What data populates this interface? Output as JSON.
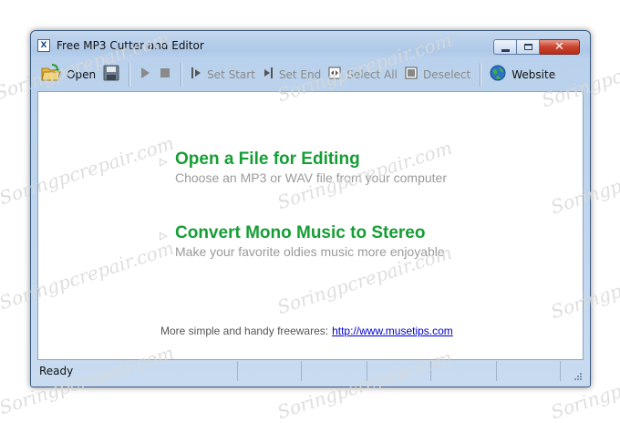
{
  "window": {
    "title": "Free MP3 Cutter and Editor",
    "app_icon_text": "X",
    "close_glyph": "✕"
  },
  "toolbar": {
    "open": "Open",
    "set_start": "Set Start",
    "set_end": "Set End",
    "select_all": "Select All",
    "deselect": "Deselect",
    "website": "Website"
  },
  "tasks": [
    {
      "title": "Open a File for Editing",
      "subtitle": "Choose an MP3 or WAV file from your computer"
    },
    {
      "title": "Convert Mono Music to Stereo",
      "subtitle": "Make your favorite oldies music more enjoyable"
    }
  ],
  "footer": {
    "text": "More simple and handy freewares:",
    "link": "http://www.musetips.com"
  },
  "status": {
    "text": "Ready"
  },
  "watermark": "Soringpcrepair.com",
  "colors": {
    "task_title": "#169e35",
    "link": "#0000cc",
    "close_button": "#c9432d"
  }
}
